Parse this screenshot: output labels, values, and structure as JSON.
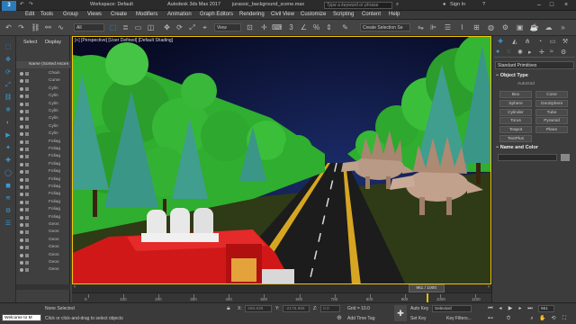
{
  "title_bar": {
    "workspace": "Workspace: Default",
    "app_title": "Autodesk 3ds Max 2017",
    "file_path": "jurassic_background_scene.max",
    "search_placeholder": "Type a keyword or phrase",
    "sign_in": "Sign In",
    "logo_text": "3"
  },
  "menu": [
    "Edit",
    "Tools",
    "Group",
    "Views",
    "Create",
    "Modifiers",
    "Animation",
    "Graph Editors",
    "Rendering",
    "Civil View",
    "Customize",
    "Scripting",
    "Content",
    "Help"
  ],
  "toolbar": {
    "selection_filter": "All",
    "reference_coord": "View",
    "selection_set": "Create Selection Se"
  },
  "explorer": {
    "tab_select": "Select",
    "tab_display": "Display",
    "header": "Name (Sorted Ascen",
    "rows": [
      "Chain",
      "Curve",
      "Cylin",
      "Cylin",
      "Cylin",
      "Cylin",
      "Cylin",
      "Cylin",
      "Cylin",
      "Foliag",
      "Foliag",
      "Foliag",
      "Foliag",
      "Foliag",
      "Foliag",
      "Foliag",
      "Foliag",
      "Foliag",
      "Foliag",
      "Foliag",
      "Geos",
      "Geos",
      "Geos",
      "Geos",
      "Geos",
      "Geos",
      "Geos"
    ]
  },
  "viewport": {
    "label": "[+] [Perspective] [User Defined] [Default Shading]"
  },
  "command_panel": {
    "category": "Standard Primitives",
    "section_object_type": "Object Type",
    "autogrid": "AutoGrid",
    "buttons": [
      "Box",
      "Cone",
      "Sphere",
      "GeoSphere",
      "Cylinder",
      "Tube",
      "Torus",
      "Pyramid",
      "Teapot",
      "Plane",
      "TextPlus"
    ],
    "section_name_color": "Name and Color"
  },
  "timeline": {
    "frame_display": "961 / 1000",
    "current_fraction": 0.961,
    "ticks": [
      "0",
      "100",
      "200",
      "300",
      "400",
      "500",
      "600",
      "700",
      "800",
      "900",
      "1000",
      "1100"
    ]
  },
  "status": {
    "maxscript": "Welcome to M",
    "selection": "None Selected",
    "prompt": "Click or click-and-drag to select objects",
    "x_label": "X:",
    "x_value": "298.939",
    "y_label": "Y:",
    "y_value": "-2178.895",
    "z_label": "Z:",
    "z_value": "0.0",
    "grid": "Grid = 10.0",
    "add_time_tag": "Add Time Tag",
    "auto_key": "Auto Key",
    "auto_key_mode": "Selected",
    "set_key": "Set Key",
    "key_filters": "Key Filters...",
    "frame_field": "961"
  },
  "colors": {
    "accent": "#3a9ad9",
    "viewport_border": "#f5c400",
    "sky": "#0b0f2a",
    "tree_green": "#2fae2f",
    "truck_red": "#d11818"
  }
}
